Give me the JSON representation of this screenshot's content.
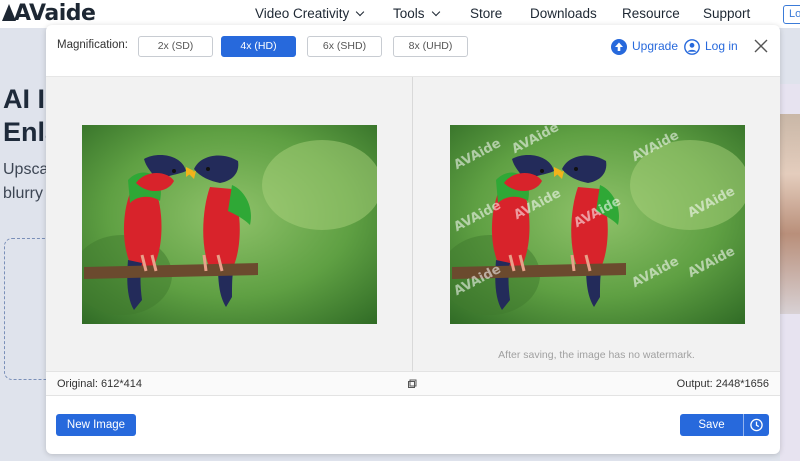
{
  "site": {
    "logo_text": "AVaide",
    "nav": [
      "Video Creativity",
      "Tools",
      "Store",
      "Downloads",
      "Resource",
      "Support"
    ],
    "login_partial": "Lo",
    "hero_title_lines": [
      "AI I",
      "Enla"
    ],
    "hero_sub_lines": [
      "Upsca",
      "blurry"
    ]
  },
  "modal": {
    "magnification_label": "Magnification:",
    "scales": [
      "2x (SD)",
      "4x (HD)",
      "6x (SHD)",
      "8x (UHD)"
    ],
    "selected_scale": "4x (HD)",
    "upgrade_label": "Upgrade",
    "login_label": "Log in",
    "watermark_text": "AVAide",
    "watermark_note": "After saving, the image has no watermark.",
    "original_size": "Original: 612*414",
    "output_size": "Output: 2448*1656",
    "new_image_label": "New Image",
    "save_label": "Save"
  },
  "colors": {
    "accent": "#2769dc",
    "page_bg": "#dfe3ec",
    "bird_red": "#d8232b",
    "bird_green": "#2fa836",
    "bird_navy": "#232b5a"
  },
  "icons": {
    "upgrade": "upload-circle-icon",
    "login": "user-circle-icon",
    "close": "close-icon",
    "compare": "compare-icon",
    "history": "clock-icon"
  }
}
